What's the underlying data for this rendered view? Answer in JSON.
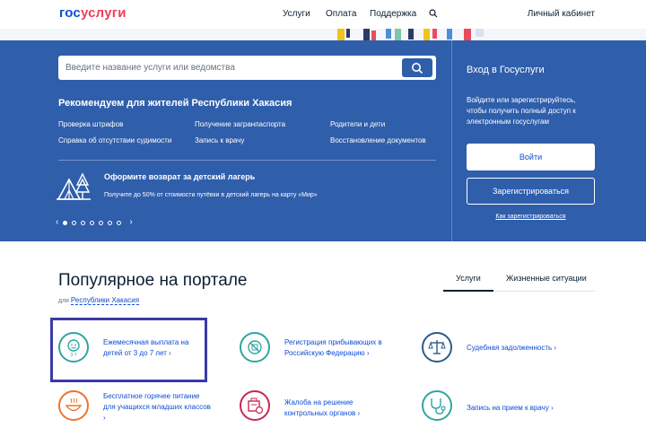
{
  "header": {
    "logo_gos": "гос",
    "logo_uslugi": "услуги",
    "nav": [
      "Услуги",
      "Оплата",
      "Поддержка"
    ],
    "cabinet": "Личный кабинет"
  },
  "hero": {
    "search": {
      "placeholder": "Введите название услуги или ведомства"
    },
    "recommend_title": "Рекомендуем для жителей Республики Хакасия",
    "recommend_links": [
      "Проверка штрафов",
      "Получение загранпаспорта",
      "Родители и дети",
      "Справка об отсутствии судимости",
      "Запись к врачу",
      "Восстановление документов"
    ],
    "camp": {
      "title": "Оформите возврат за детский лагерь",
      "text": "Получите до 50% от стоимости путёвки в детский лагерь на карту «Мир»"
    },
    "carousel": {
      "dots": 7,
      "active": 1
    }
  },
  "login": {
    "title": "Вход в Госуслуги",
    "text": "Войдите или зарегистрируйтесь, чтобы получить полный доступ к электронным госуслугам",
    "login_button": "Войти",
    "register_button": "Зарегистрироваться",
    "how_register": "Как зарегистрироваться"
  },
  "popular": {
    "title": "Популярное на портале",
    "for_label": "для",
    "region": "Республики Хакасия",
    "tabs": [
      "Услуги",
      "Жизненные ситуации"
    ],
    "services": [
      {
        "label": "Ежемесячная выплата на детей от 3 до 7 лет ›",
        "icon": "child-icon"
      },
      {
        "label": "Регистрация прибывающих в Российскую Федерацию ›",
        "icon": "passport-icon"
      },
      {
        "label": "Судебная задолженность ›",
        "icon": "scales-icon"
      },
      {
        "label": "Бесплатное горячее питание для учащихся младших классов ›",
        "icon": "food-bowl-icon"
      },
      {
        "label": "Жалоба на решение контрольных органов ›",
        "icon": "complaint-icon"
      },
      {
        "label": "Запись на прием к врачу ›",
        "icon": "stethoscope-icon"
      }
    ]
  },
  "colors": {
    "brand_blue": "#0d4cd3",
    "hero_blue": "#2f5eab",
    "brand_red": "#ee3f58",
    "teal": "#2fa6a0",
    "orange": "#e8762d",
    "crimson": "#c8284f",
    "navy": "#2d5a8c",
    "highlight": "#3d3aa8"
  }
}
